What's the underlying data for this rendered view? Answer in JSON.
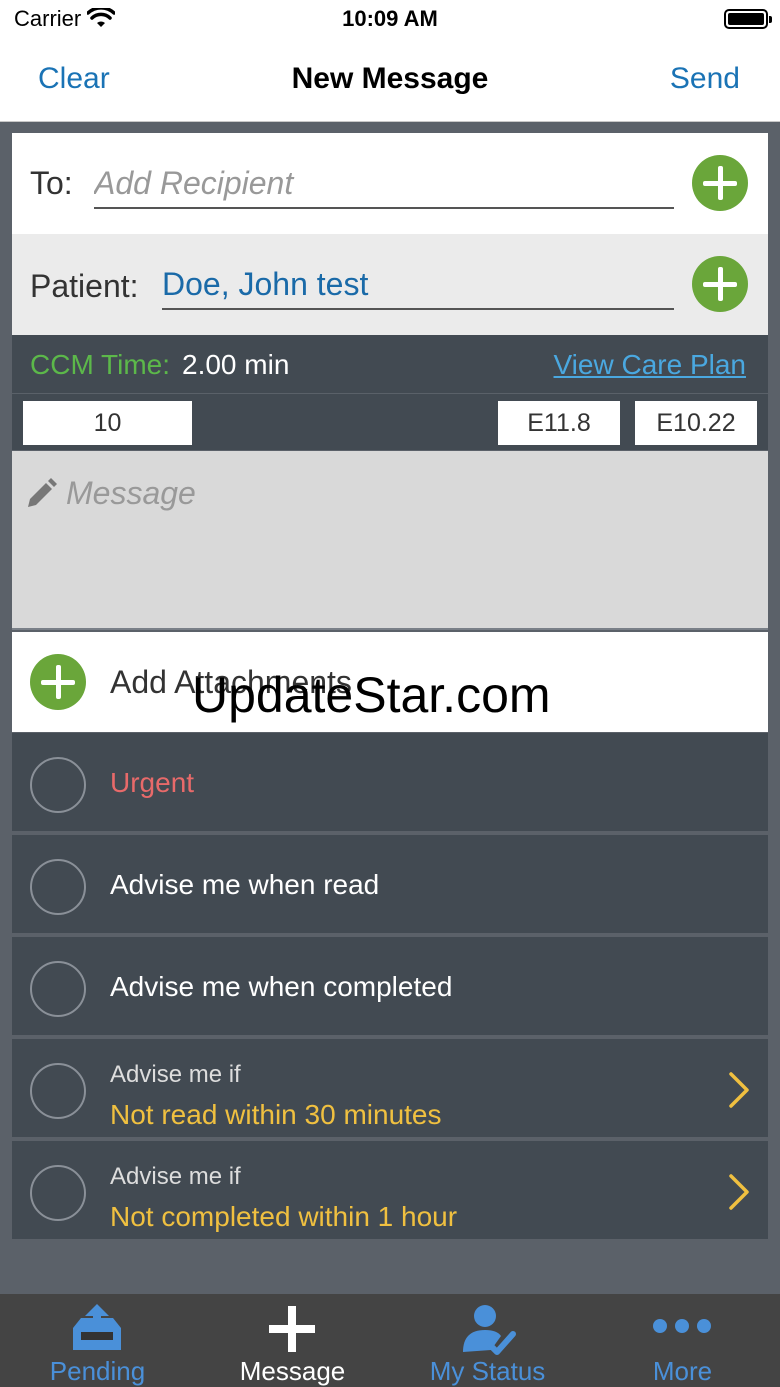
{
  "status_bar": {
    "carrier": "Carrier",
    "time": "10:09 AM",
    "wifi_icon": "wifi-icon",
    "battery_icon": "battery-icon"
  },
  "nav": {
    "clear_label": "Clear",
    "title": "New Message",
    "send_label": "Send"
  },
  "recipient": {
    "label": "To:",
    "placeholder": "Add Recipient",
    "value": ""
  },
  "patient": {
    "label": "Patient:",
    "value": "Doe, John test"
  },
  "ccm": {
    "label": "CCM Time:",
    "value": "2.00 min",
    "care_plan_link": "View Care Plan"
  },
  "codes": [
    "10",
    "E11.8",
    "E10.22"
  ],
  "message": {
    "placeholder": "Message"
  },
  "attachments": {
    "label": "Add Attachments"
  },
  "watermark": "UpdateStar.com",
  "options": [
    {
      "label": "Urgent",
      "color": "#e86a6a"
    },
    {
      "label": "Advise me when read"
    },
    {
      "label": "Advise me when completed"
    },
    {
      "sub": "Advise me if",
      "value": "Not read within 30 minutes"
    },
    {
      "sub": "Advise me if",
      "value": "Not completed within 1 hour"
    }
  ],
  "tabs": [
    {
      "label": "Pending",
      "icon": "inbox-upload-icon"
    },
    {
      "label": "Message",
      "icon": "plus-icon"
    },
    {
      "label": "My Status",
      "icon": "user-check-icon"
    },
    {
      "label": "More",
      "icon": "more-dots-icon"
    }
  ],
  "colors": {
    "accent_blue": "#1a73b5",
    "add_green": "#6aa63a",
    "ccm_green": "#5cb84a",
    "alert_yellow": "#f0c040",
    "dark_panel": "#424a52"
  }
}
